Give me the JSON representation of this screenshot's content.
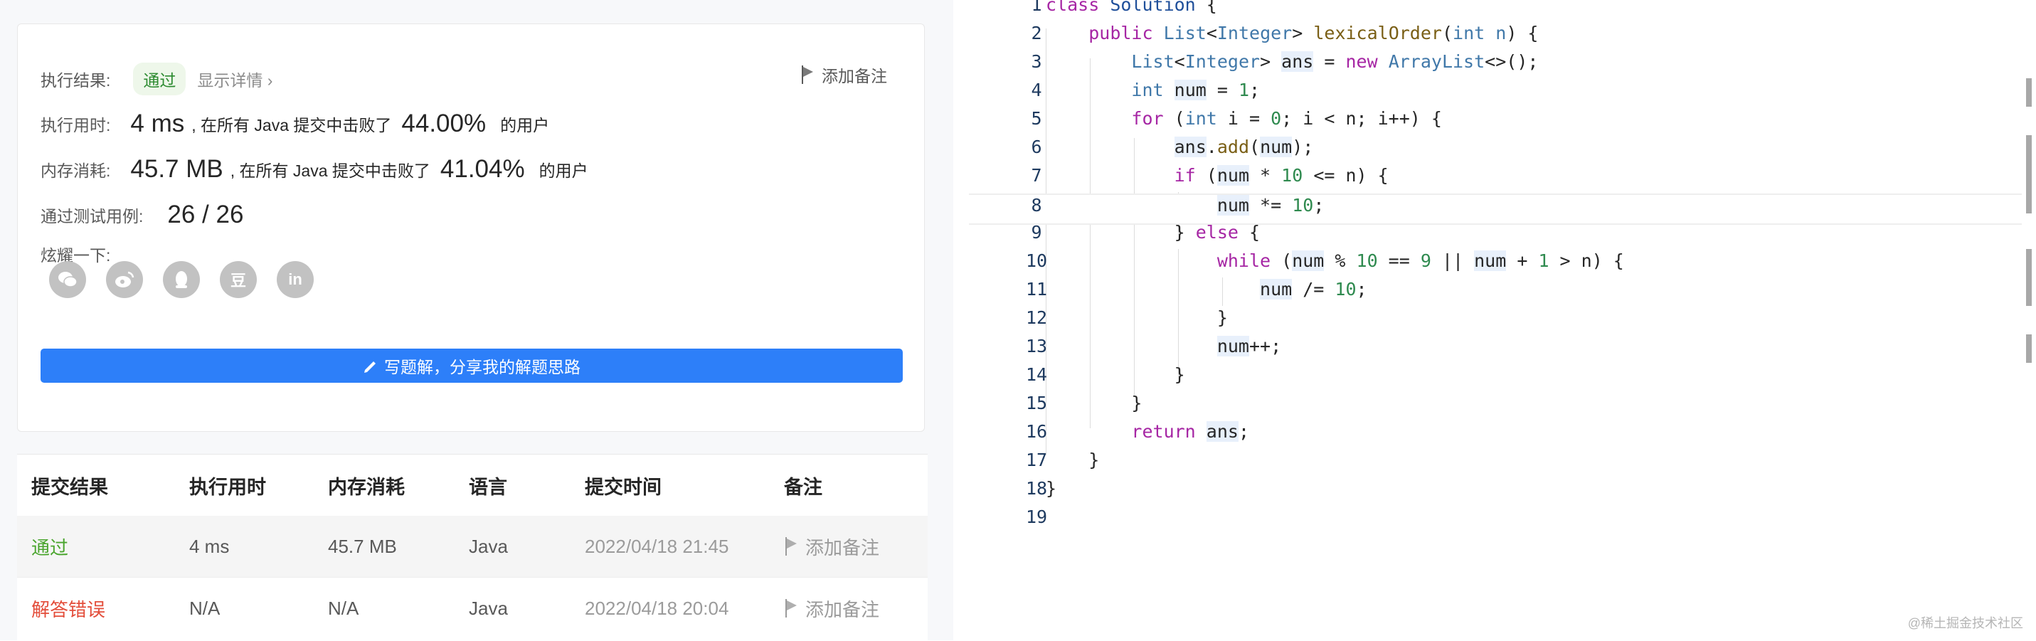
{
  "result": {
    "label": "执行结果:",
    "status": "通过",
    "details_link": "显示详情 ›",
    "add_note": "添加备注",
    "runtime_label": "执行用时:",
    "runtime_value": "4 ms",
    "runtime_text": ", 在所有 Java 提交中击败了",
    "runtime_percent": "44.00%",
    "users_text": "的用户",
    "memory_label": "内存消耗:",
    "memory_value": "45.7 MB",
    "memory_text": ", 在所有 Java 提交中击败了",
    "memory_percent": "41.04%",
    "testcases_label": "通过测试用例:",
    "testcases_value": "26 / 26",
    "share_label": "炫耀一下:",
    "share_icons": [
      "wechat-icon",
      "weibo-icon",
      "qq-icon",
      "douban-icon",
      "linkedin-icon"
    ],
    "douban_glyph": "豆",
    "linkedin_glyph": "in",
    "write_button": "写题解，分享我的解题思路"
  },
  "table": {
    "headers": [
      "提交结果",
      "执行用时",
      "内存消耗",
      "语言",
      "提交时间",
      "备注"
    ],
    "rows": [
      {
        "result": "通过",
        "runtime": "4 ms",
        "memory": "45.7 MB",
        "language": "Java",
        "time": "2022/04/18 21:45",
        "note": "添加备注"
      },
      {
        "result": "解答错误",
        "runtime": "N/A",
        "memory": "N/A",
        "language": "Java",
        "time": "2022/04/18 20:04",
        "note": "添加备注"
      }
    ]
  },
  "editor": {
    "lines": [
      "class Solution {",
      "    public List<Integer> lexicalOrder(int n) {",
      "        List<Integer> ans = new ArrayList<>();",
      "        int num = 1;",
      "        for (int i = 0; i < n; i++) {",
      "            ans.add(num);",
      "            if (num * 10 <= n) {",
      "                num *= 10;",
      "            } else {",
      "                while (num % 10 == 9 || num + 1 > n) {",
      "                    num /= 10;",
      "                }",
      "                num++;",
      "            }",
      "        }",
      "        return ans;",
      "    }",
      "}",
      ""
    ],
    "current_line": 8
  },
  "watermark": "@稀土掘金技术社区",
  "colors": {
    "accent": "#2d7ff9",
    "success": "#4aa52e",
    "error": "#e34d3a"
  }
}
